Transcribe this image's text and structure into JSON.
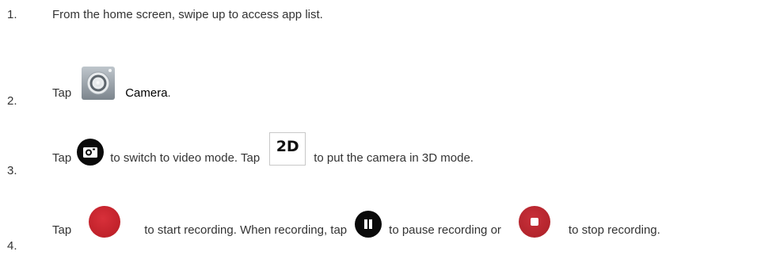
{
  "steps": [
    {
      "number": "1.",
      "text": "From the home screen, swipe up to access app list."
    },
    {
      "number": "2.",
      "before": "Tap",
      "icon": "camera-app-icon",
      "label": "Camera",
      "after": "."
    },
    {
      "number": "3.",
      "before": "Tap",
      "icon1": "video-mode-switch-icon",
      "middle": "to switch to video mode. Tap",
      "icon2_label": "2D",
      "after": "to put the camera in 3D mode."
    },
    {
      "number": "4.",
      "before": "Tap",
      "icon1": "record-icon",
      "middle1": "to start recording. When recording, tap",
      "icon2": "pause-icon",
      "middle2": "to pause recording or",
      "icon3": "stop-icon",
      "after": "to stop recording."
    }
  ],
  "colors": {
    "text": "#333333",
    "record_red": "#c0212a",
    "icon_black": "#0a0a0a"
  }
}
